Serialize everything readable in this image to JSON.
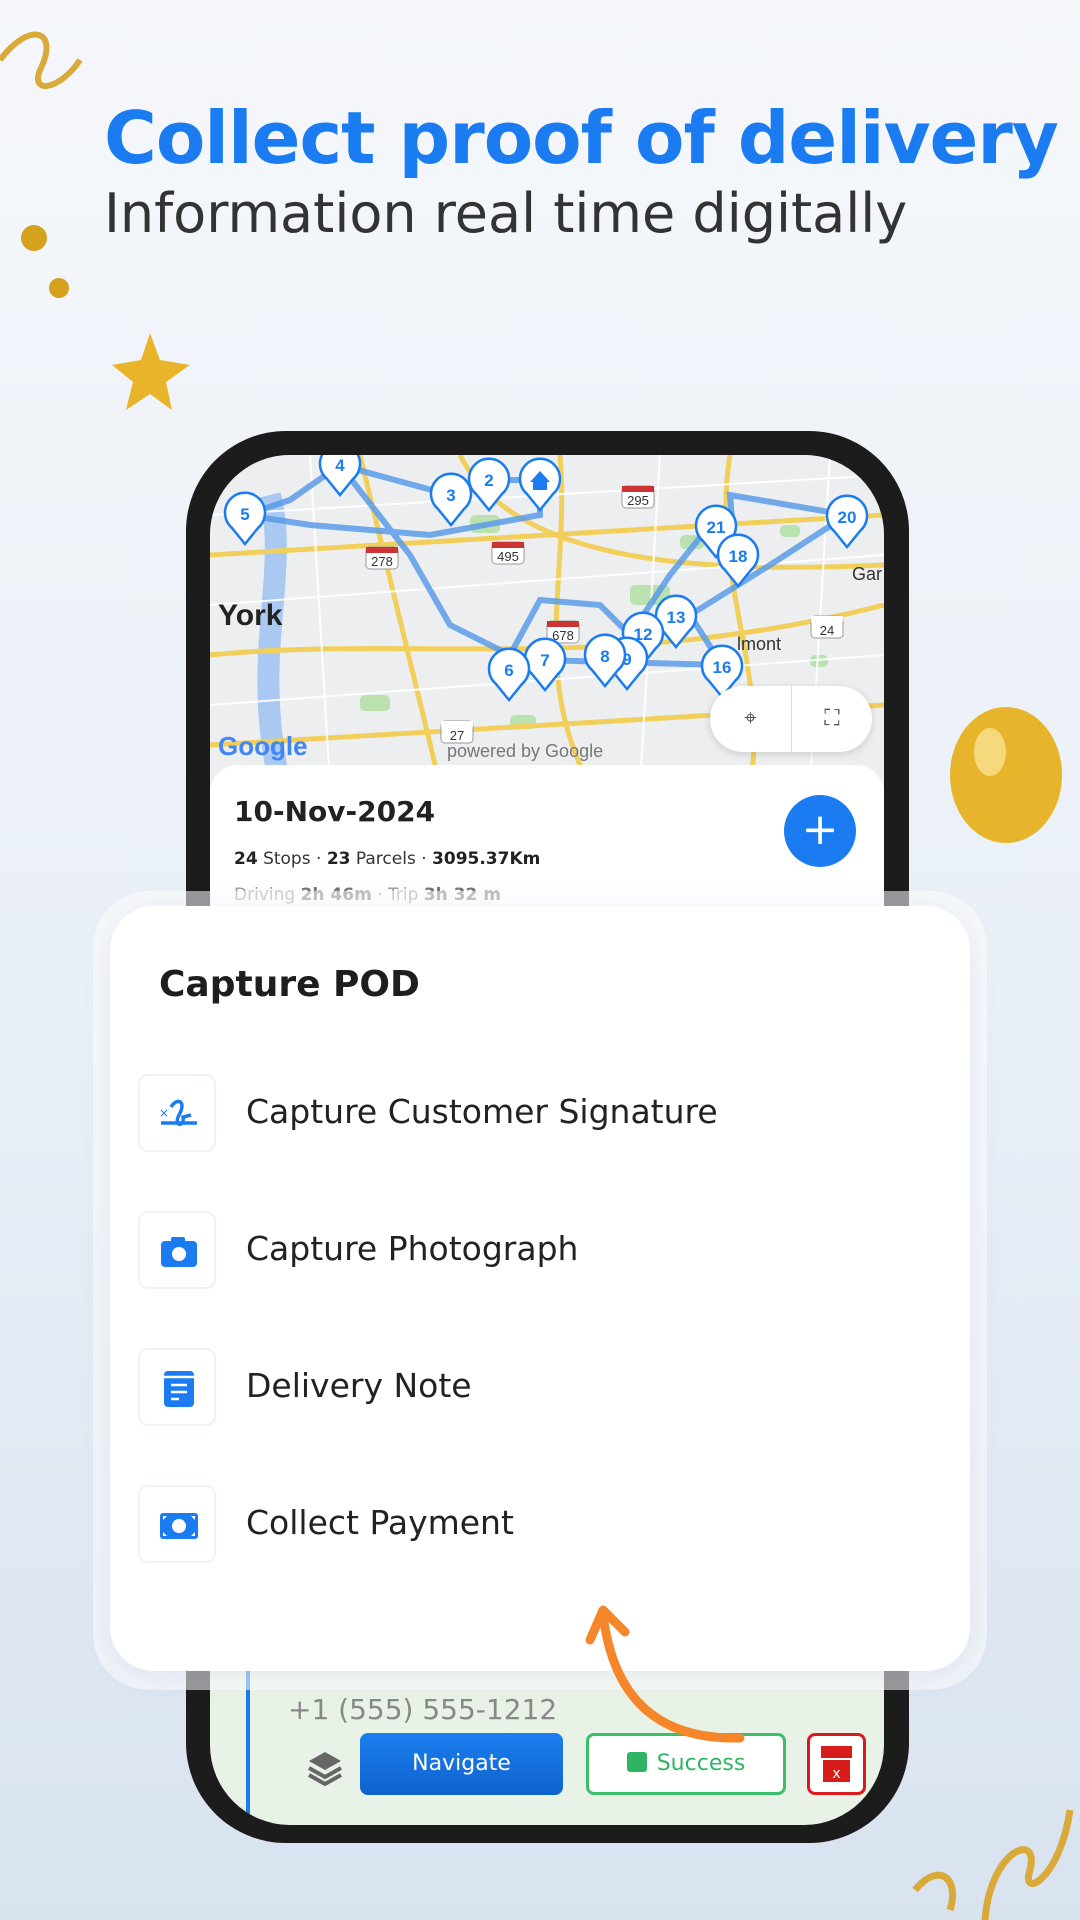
{
  "hero": {
    "title": "Collect proof of delivery",
    "subtitle": "Information real time digitally"
  },
  "map": {
    "markers": [
      "5",
      "4",
      "3",
      "2",
      "home",
      "21",
      "20",
      "18",
      "13",
      "12",
      "9",
      "8",
      "7",
      "6",
      "16"
    ],
    "shields": [
      "278",
      "495",
      "295",
      "678",
      "24",
      "27"
    ],
    "labels": {
      "city": "York",
      "gar": "Gar",
      "lmont": "lmont",
      "google": "Google",
      "powered": "powered by Google"
    },
    "controls": {
      "locate": "crosshair-icon",
      "fullscreen": "fullscreen-icon"
    }
  },
  "trip": {
    "date": "10-Nov-2024",
    "stops_count": "24",
    "stops_label": "Stops",
    "parcels_count": "23",
    "parcels_label": "Parcels",
    "distance": "3095.37Km",
    "driving_label": "Driving",
    "driving_time": "2h 46m",
    "trip_label": "Trip",
    "trip_time": "3h 32 m",
    "add_icon": "plus-icon"
  },
  "stop": {
    "phone": "+1 (555) 555-1212"
  },
  "actions": {
    "navigate": "Navigate",
    "success": "Success",
    "fail_icon": "failed-parcel-icon"
  },
  "pod": {
    "title": "Capture POD",
    "items": [
      {
        "label": "Capture Customer Signature",
        "icon": "signature-icon"
      },
      {
        "label": "Capture Photograph",
        "icon": "camera-icon"
      },
      {
        "label": "Delivery Note",
        "icon": "note-icon"
      },
      {
        "label": "Collect Payment",
        "icon": "payment-icon"
      }
    ]
  },
  "colors": {
    "accent": "#1a7cf0",
    "success": "#2fb561",
    "danger": "#d81b1b",
    "arrow": "#f5862a"
  }
}
